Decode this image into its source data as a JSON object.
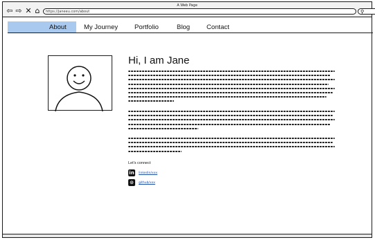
{
  "window": {
    "title": "A Web Page"
  },
  "browser": {
    "url": "https://janeeu.com/about",
    "icons": [
      "back-icon",
      "forward-icon",
      "stop-icon",
      "home-icon",
      "search-icon"
    ]
  },
  "nav": {
    "items": [
      {
        "label": "About",
        "active": true
      },
      {
        "label": "My Journey"
      },
      {
        "label": "Portfolio"
      },
      {
        "label": "Blog"
      },
      {
        "label": "Contact"
      }
    ],
    "active_color": "#a9c9ef"
  },
  "main": {
    "heading": "Hi, I am Jane",
    "connect_label": "Let's connect",
    "social": [
      {
        "icon": "linkedin-icon",
        "badge": "in",
        "label": "linkedin/xxx"
      },
      {
        "icon": "github-icon",
        "badge": "⊙",
        "label": "github/xxx"
      }
    ]
  }
}
